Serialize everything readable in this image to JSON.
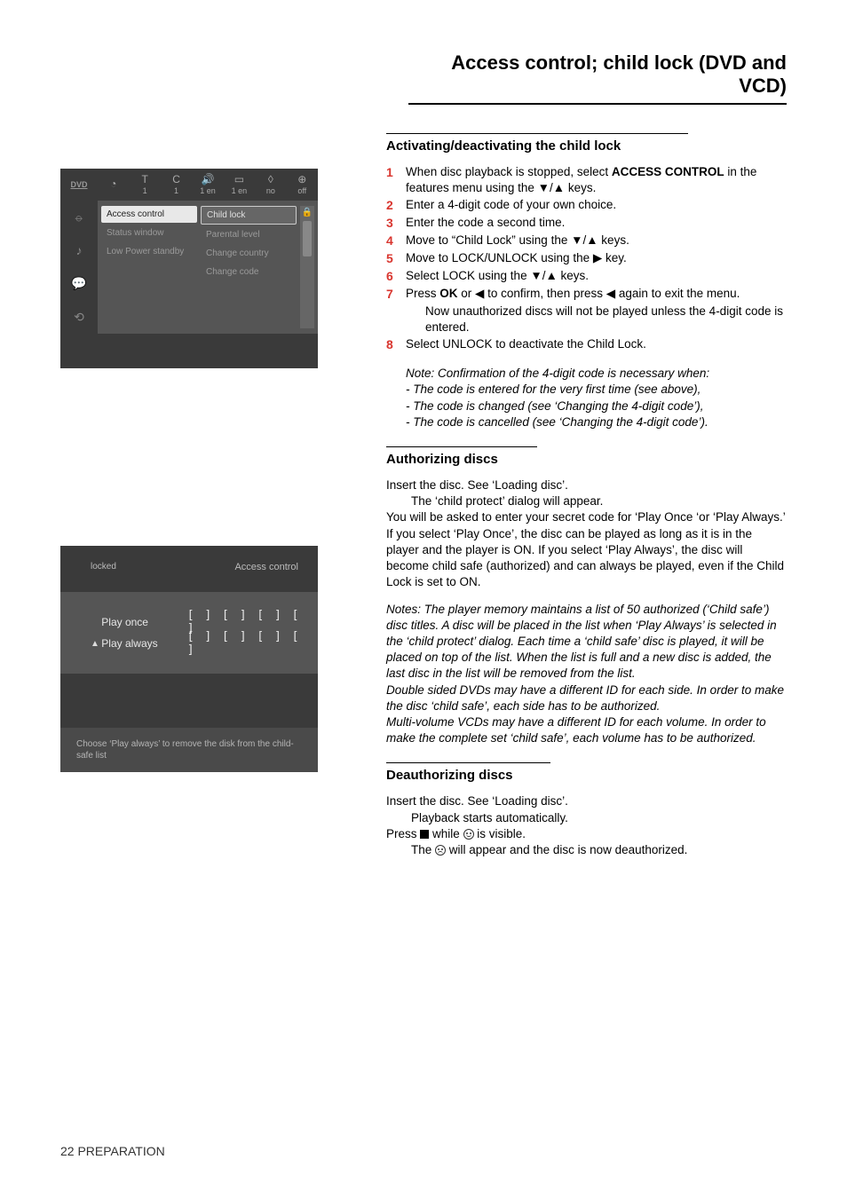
{
  "page_title": "Access control; child lock (DVD and VCD)",
  "sections": {
    "activate": {
      "heading": "Activating/deactivating the child lock",
      "steps": [
        {
          "n": "1",
          "text_a": "When disc playback is stopped, select ",
          "bold": "ACCESS CONTROL",
          "text_b": " in the features menu using the ▼/▲ keys."
        },
        {
          "n": "2",
          "text": "Enter a 4-digit code of your own choice."
        },
        {
          "n": "3",
          "text": "Enter the code a second time."
        },
        {
          "n": "4",
          "text": "Move to “Child Lock” using the ▼/▲  keys."
        },
        {
          "n": "5",
          "text": "Move to LOCK/UNLOCK using the ▶  key."
        },
        {
          "n": "6",
          "text": "Select LOCK using the ▼/▲  keys."
        },
        {
          "n": "7",
          "text_a": "Press ",
          "bold": "OK",
          "text_b": " or ◀ to confirm, then press ◀ again to exit the menu."
        },
        {
          "sub": "Now unauthorized discs will not be played unless the 4-digit code is entered."
        },
        {
          "n": "8",
          "text": "Select UNLOCK to deactivate the Child Lock."
        }
      ],
      "note_lead": "Note: Confirmation of the 4-digit code is necessary when:",
      "note_lines": [
        "- The code is entered for the very first time (see above),",
        "- The code is changed (see ‘Changing the 4-digit code’),",
        "- The code is cancelled (see ‘Changing the 4-digit code’)."
      ]
    },
    "authorizing": {
      "heading": "Authorizing discs",
      "p1_a": "Insert the disc. See ‘Loading disc’.",
      "p1_b": "The ‘child protect’ dialog will appear.",
      "p2": "You will be asked to enter your secret code for ‘Play Once ‘or ‘Play Always.’ If you select ‘Play Once’, the disc can be played as long as it is in the player and the player is ON. If you select ‘Play Always’, the disc will become child safe (authorized) and can always be played, even if the Child Lock is set to ON.",
      "notes1": "Notes: The player memory maintains a list of 50 authorized (‘Child safe’) disc titles. A disc will be placed in the list when ‘Play Always’ is selected in the ‘child protect’ dialog. Each time a ‘child safe’ disc is played, it will be placed on top of the list. When the list is full and a new disc is added, the last disc in the list will be removed from the list.",
      "notes2": "Double sided DVDs may have a different ID for each side. In order to make the disc ‘child safe’, each side has to be authorized.",
      "notes3": "Multi-volume VCDs may have a different ID for each volume. In order to make the complete set ‘child safe’, each volume has to be authorized."
    },
    "deauth": {
      "heading": "Deauthorizing discs",
      "l1": "Insert the disc. See ‘Loading disc’.",
      "l2": "Playback starts automatically.",
      "l3_a": "Press ",
      "l3_b": "  while ",
      "l3_c": " is visible.",
      "l4_a": "The ",
      "l4_b": " will appear and the disc is now deauthorized."
    }
  },
  "dvd_menu": {
    "top_icons": [
      {
        "glyph": "◔",
        "label": ""
      },
      {
        "glyph": "T",
        "label": "1"
      },
      {
        "glyph": "C",
        "label": "1"
      },
      {
        "glyph": "🔊",
        "label": "1 en"
      },
      {
        "glyph": "▭",
        "label": "1 en"
      },
      {
        "glyph": "◊",
        "label": "no"
      },
      {
        "glyph": "⊕",
        "label": "off"
      }
    ],
    "left_icons": [
      "⦵",
      "♪",
      "💬",
      "⟲"
    ],
    "col1": [
      {
        "label": "Access control",
        "cls": "sel-white"
      },
      {
        "label": "Status window",
        "cls": ""
      },
      {
        "label": "Low Power standby",
        "cls": ""
      }
    ],
    "col2": [
      {
        "label": "Child lock",
        "cls": "sel-outline"
      },
      {
        "label": "Parental level",
        "cls": ""
      },
      {
        "label": "Change country",
        "cls": ""
      },
      {
        "label": "Change code",
        "cls": ""
      }
    ],
    "scroll_top": "🔒"
  },
  "ac_dialog": {
    "locked_label": "locked",
    "title": "Access control",
    "rows": [
      {
        "arrow": "",
        "label": "Play once",
        "slots": "[ ] [ ] [ ] [ ]"
      },
      {
        "arrow": "▲",
        "label": "Play always",
        "slots": "[ ] [ ] [ ] [ ]"
      }
    ],
    "footer": "Choose ‘Play always’ to remove the disk from the child-safe list"
  },
  "footer": {
    "page": "22",
    "label": "PREPARATION"
  }
}
